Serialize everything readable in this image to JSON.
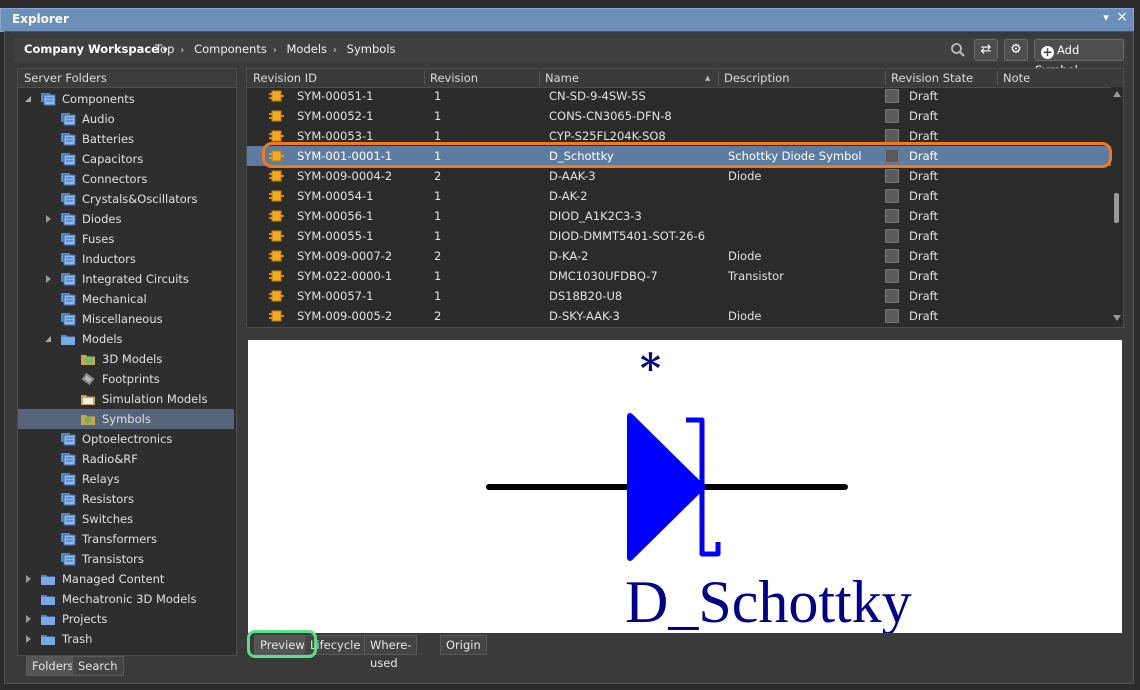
{
  "window": {
    "title": "Explorer",
    "menu_glyph": "▾",
    "close_glyph": "×"
  },
  "toolbar": {
    "workspace": "Company Workspace",
    "workspace_caret": "▾",
    "breadcrumbs": [
      "Top",
      "Components",
      "Models",
      "Symbols"
    ],
    "breadcrumb_sep": "›",
    "refresh_glyph": "⇄",
    "settings_glyph": "⚙",
    "add_plus": "+",
    "add_button": "Add Symbol"
  },
  "left_panel": {
    "header": "Server Folders",
    "tree": [
      {
        "label": "Components",
        "level": 0,
        "expander": "open",
        "icon": "component-folder-icon"
      },
      {
        "label": "Audio",
        "level": 1,
        "expander": "",
        "icon": "component-folder-icon"
      },
      {
        "label": "Batteries",
        "level": 1,
        "expander": "",
        "icon": "component-folder-icon"
      },
      {
        "label": "Capacitors",
        "level": 1,
        "expander": "",
        "icon": "component-folder-icon"
      },
      {
        "label": "Connectors",
        "level": 1,
        "expander": "",
        "icon": "component-folder-icon"
      },
      {
        "label": "Crystals&Oscillators",
        "level": 1,
        "expander": "",
        "icon": "component-folder-icon"
      },
      {
        "label": "Diodes",
        "level": 1,
        "expander": "closed",
        "icon": "component-folder-icon"
      },
      {
        "label": "Fuses",
        "level": 1,
        "expander": "",
        "icon": "component-folder-icon"
      },
      {
        "label": "Inductors",
        "level": 1,
        "expander": "",
        "icon": "component-folder-icon"
      },
      {
        "label": "Integrated Circuits",
        "level": 1,
        "expander": "closed",
        "icon": "component-folder-icon"
      },
      {
        "label": "Mechanical",
        "level": 1,
        "expander": "",
        "icon": "component-folder-icon"
      },
      {
        "label": "Miscellaneous",
        "level": 1,
        "expander": "",
        "icon": "component-folder-icon"
      },
      {
        "label": "Models",
        "level": 1,
        "expander": "open",
        "icon": "folder-icon"
      },
      {
        "label": "3D Models",
        "level": 2,
        "expander": "",
        "icon": "3d-model-folder-icon"
      },
      {
        "label": "Footprints",
        "level": 2,
        "expander": "",
        "icon": "footprint-folder-icon"
      },
      {
        "label": "Simulation Models",
        "level": 2,
        "expander": "",
        "icon": "simulation-folder-icon"
      },
      {
        "label": "Symbols",
        "level": 2,
        "expander": "",
        "icon": "symbol-folder-icon",
        "selected": true
      },
      {
        "label": "Optoelectronics",
        "level": 1,
        "expander": "",
        "icon": "component-folder-icon"
      },
      {
        "label": "Radio&RF",
        "level": 1,
        "expander": "",
        "icon": "component-folder-icon"
      },
      {
        "label": "Relays",
        "level": 1,
        "expander": "",
        "icon": "component-folder-icon"
      },
      {
        "label": "Resistors",
        "level": 1,
        "expander": "",
        "icon": "component-folder-icon"
      },
      {
        "label": "Switches",
        "level": 1,
        "expander": "",
        "icon": "component-folder-icon"
      },
      {
        "label": "Transformers",
        "level": 1,
        "expander": "",
        "icon": "component-folder-icon"
      },
      {
        "label": "Transistors",
        "level": 1,
        "expander": "",
        "icon": "component-folder-icon"
      },
      {
        "label": "Managed Content",
        "level": 0,
        "expander": "closed",
        "icon": "folder-icon"
      },
      {
        "label": "Mechatronic 3D Models",
        "level": 0,
        "expander": "",
        "icon": "folder-icon"
      },
      {
        "label": "Projects",
        "level": 0,
        "expander": "closed",
        "icon": "projects-folder-icon"
      },
      {
        "label": "Trash",
        "level": 0,
        "expander": "closed",
        "icon": "folder-icon"
      }
    ],
    "tabs": [
      "Folders",
      "Search"
    ]
  },
  "grid": {
    "columns": [
      "Revision ID",
      "Revision",
      "Name",
      "Description",
      "Revision State",
      "Note"
    ],
    "sort_glyph": "▲",
    "rows": [
      {
        "id": "SYM-00051-1",
        "rev": "1",
        "name": "CN-SD-9-4SW-5S",
        "desc": "",
        "state": "Draft"
      },
      {
        "id": "SYM-00052-1",
        "rev": "1",
        "name": "CONS-CN3065-DFN-8",
        "desc": "",
        "state": "Draft"
      },
      {
        "id": "SYM-00053-1",
        "rev": "1",
        "name": "CYP-S25FL204K-SO8",
        "desc": "",
        "state": "Draft"
      },
      {
        "id": "SYM-001-0001-1",
        "rev": "1",
        "name": "D_Schottky",
        "desc": "Schottky Diode Symbol",
        "state": "Draft",
        "selected": true
      },
      {
        "id": "SYM-009-0004-2",
        "rev": "2",
        "name": "D-AAK-3",
        "desc": "Diode",
        "state": "Draft"
      },
      {
        "id": "SYM-00054-1",
        "rev": "1",
        "name": "D-AK-2",
        "desc": "",
        "state": "Draft"
      },
      {
        "id": "SYM-00056-1",
        "rev": "1",
        "name": "DIOD_A1K2C3-3",
        "desc": "",
        "state": "Draft"
      },
      {
        "id": "SYM-00055-1",
        "rev": "1",
        "name": "DIOD-DMMT5401-SOT-26-6",
        "desc": "",
        "state": "Draft"
      },
      {
        "id": "SYM-009-0007-2",
        "rev": "2",
        "name": "D-KA-2",
        "desc": "Diode",
        "state": "Draft"
      },
      {
        "id": "SYM-022-0000-1",
        "rev": "1",
        "name": "DMC1030UFDBQ-7",
        "desc": "Transistor",
        "state": "Draft"
      },
      {
        "id": "SYM-00057-1",
        "rev": "1",
        "name": "DS18B20-U8",
        "desc": "",
        "state": "Draft"
      },
      {
        "id": "SYM-009-0005-2",
        "rev": "2",
        "name": "D-SKY-AAK-3",
        "desc": "Diode",
        "state": "Draft"
      }
    ]
  },
  "preview": {
    "designator": "*",
    "component_name": "D_Schottky",
    "symbol_color": "#0000ff",
    "text_color": "#00008b"
  },
  "bottom_tabs": [
    "Preview",
    "Lifecycle",
    "Where-used",
    "Origin"
  ],
  "colors": {
    "highlight_orange": "#f07a1c",
    "highlight_green": "#58e08a",
    "selection_blue": "#5e7ba2",
    "title_blue": "#6b8fb8"
  }
}
